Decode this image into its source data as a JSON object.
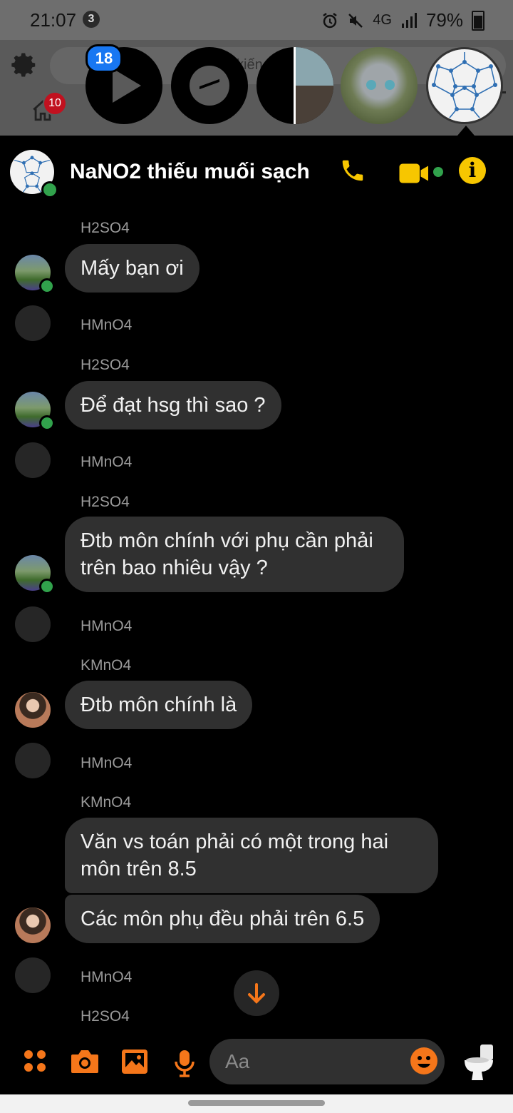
{
  "status_bar": {
    "time": "21:07",
    "notification_count": "3",
    "network": "4G",
    "battery": "79%"
  },
  "underlay": {
    "search_fragment": "kiến",
    "home_badge": "10"
  },
  "chat_heads": {
    "video_badge": "18"
  },
  "conversation": {
    "title": "NaNO2 thiếu muối sạch",
    "info_glyph": "i"
  },
  "messages": [
    {
      "sender": "H2SO4",
      "text": "Mấy bạn ơi"
    },
    {
      "sender": "H2SO4",
      "text": "Để đạt hsg thì sao ?"
    },
    {
      "sender": "H2SO4",
      "text": "Đtb môn chính với phụ cần phải trên bao nhiêu vậy ?"
    },
    {
      "sender": "KMnO4",
      "text": "Đtb môn chính là"
    },
    {
      "sender": "KMnO4",
      "text": "Văn vs toán phải có một trong hai môn trên 8.5"
    },
    {
      "sender": "KMnO4",
      "text": "Các môn phụ đều phải trên 6.5"
    }
  ],
  "typing": [
    "HMnO4",
    "HMnO4",
    "HMnO4",
    "HMnO4",
    "HMnO4",
    "H2SO4"
  ],
  "composer": {
    "placeholder": "Aa"
  },
  "icons": {
    "gear": "gear-icon",
    "home": "home-icon",
    "call": "phone-icon",
    "video": "video-camera-icon",
    "info": "info-icon",
    "more": "four-dots-icon",
    "camera": "camera-icon",
    "gallery": "image-icon",
    "mic": "microphone-icon",
    "emoji": "smiley-icon",
    "like": "toilet-sticker-icon",
    "scroll_down": "arrow-down-icon"
  },
  "colors": {
    "accent_orange": "#f5761a",
    "header_yellow": "#f7c600",
    "bubble": "#303030",
    "online": "#31a24c",
    "badge_blue": "#1877f2",
    "badge_red": "#c1111f"
  }
}
